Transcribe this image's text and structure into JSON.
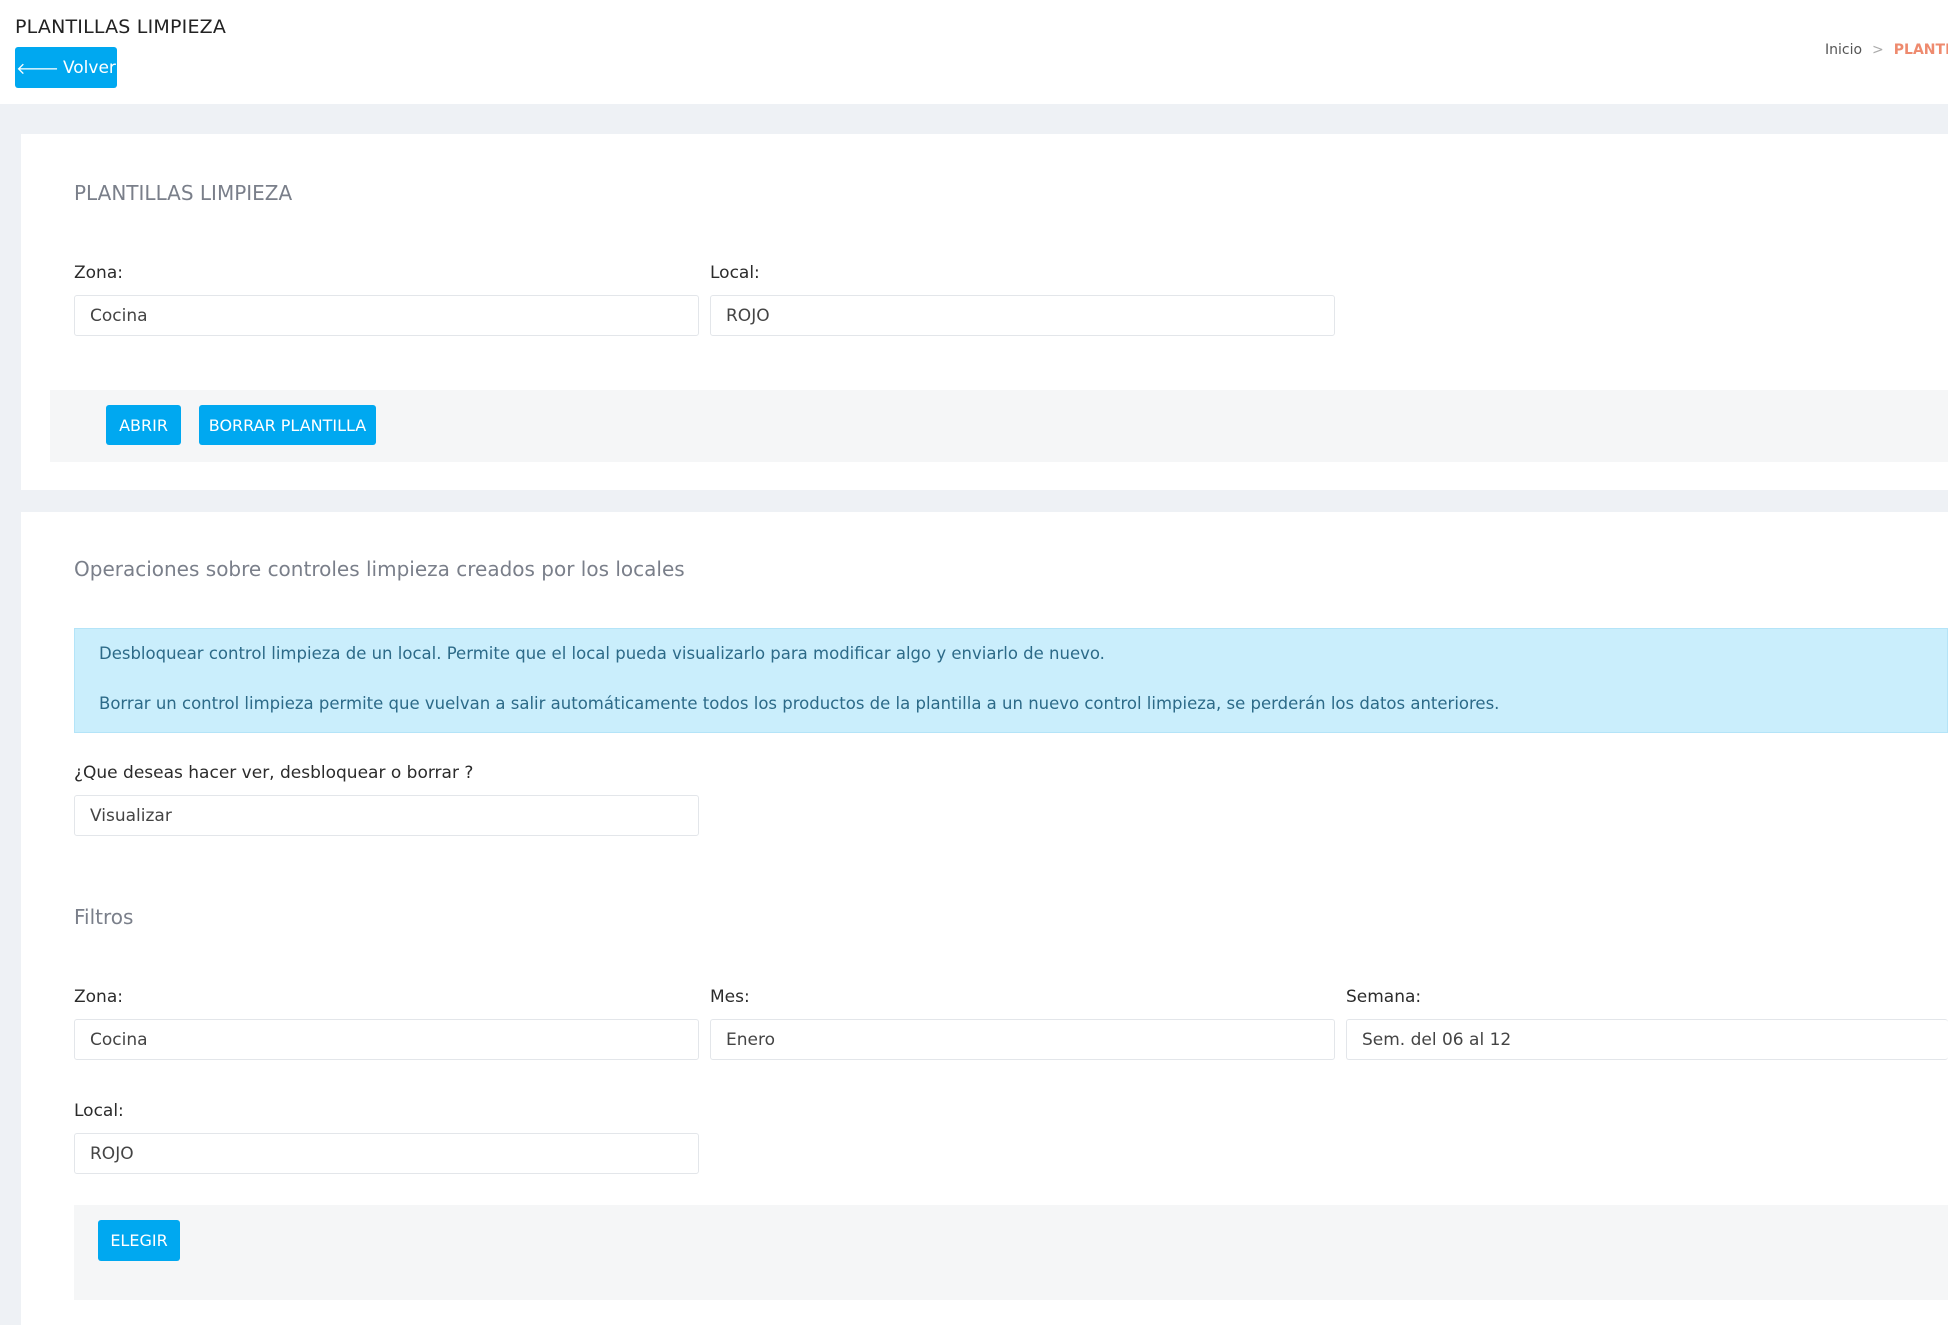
{
  "header": {
    "title": "PLANTILLAS LIMPIEZA",
    "back_label": "Volver",
    "breadcrumb": {
      "home": "Inicio",
      "separator": ">",
      "current": "PLANTIL"
    }
  },
  "templates_card": {
    "title": "PLANTILLAS LIMPIEZA",
    "zona_label": "Zona:",
    "zona_value": "Cocina",
    "local_label": "Local:",
    "local_value": "ROJO",
    "open_label": "ABRIR",
    "delete_label": "BORRAR PLANTILLA"
  },
  "operations_card": {
    "title": "Operaciones sobre controles limpieza creados por los locales",
    "info_lines": [
      "Desbloquear control limpieza de un local. Permite que el local pueda visualizarlo para modificar algo y enviarlo de nuevo.",
      "Borrar un control limpieza permite que vuelvan a salir automáticamente todos los productos de la plantilla a un nuevo control limpieza, se perderán los datos anteriores."
    ],
    "action_label": "¿Que deseas hacer ver, desbloquear o borrar ?",
    "action_value": "Visualizar",
    "filters_title": "Filtros",
    "filters": {
      "zona_label": "Zona:",
      "zona_value": "Cocina",
      "mes_label": "Mes:",
      "mes_value": "Enero",
      "semana_label": "Semana:",
      "semana_value": "Sem. del 06 al 12",
      "local_label": "Local:",
      "local_value": "ROJO"
    },
    "choose_label": "ELEGIR"
  },
  "colors": {
    "primary": "#00a8f0",
    "info_bg": "#caeefc",
    "breadcrumb_active": "#ee8a6e",
    "page_bg": "#eef1f5"
  }
}
